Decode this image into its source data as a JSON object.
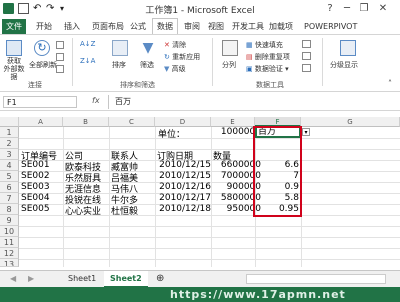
{
  "window": {
    "title": "工作簿1 - Microsoft Excel",
    "help": "?",
    "minimize": "─",
    "restore": "❐",
    "close": "✕"
  },
  "tabs": [
    "文件",
    "开始",
    "插入",
    "页面布局",
    "公式",
    "数据",
    "审阅",
    "视图",
    "开发工具",
    "加载项",
    "POWERPIVOT"
  ],
  "active_tab": "数据",
  "ribbon": {
    "get_external_label": "获取\n外部数据",
    "refresh_label": "全部刷新",
    "connections_group": "连接",
    "sort_label": "排序",
    "filter_label": "筛选",
    "clear_label": "清除",
    "reapply_label": "重新应用",
    "advanced_label": "高级",
    "sort_filter_group": "排序和筛选",
    "split_label": "分列",
    "flash_fill_label": "快速填充",
    "remove_dup_label": "删除重复项",
    "validation_label": "数据验证",
    "data_tools_group": "数据工具",
    "outline_label": "分级显示"
  },
  "formula_bar": {
    "name_box": "F1",
    "fx": "fx",
    "value": "百万"
  },
  "columns": [
    "A",
    "B",
    "C",
    "D",
    "E",
    "F",
    "G"
  ],
  "rows": [
    "1",
    "2",
    "3",
    "4",
    "5",
    "6",
    "7",
    "8",
    "9",
    "10",
    "11",
    "12",
    "13"
  ],
  "cells": {
    "D1": "单位：",
    "E1": "1000000",
    "F1": "百万",
    "A3": "订单编号",
    "B3": "公司",
    "C3": "联系人",
    "D3": "订购日期",
    "E3": "数量",
    "A4": "SE001",
    "B4": "欧泰科技",
    "C4": "臧富帅",
    "D4": "2010/12/15",
    "E4": "6600000",
    "F4": "6.6",
    "A5": "SE002",
    "B5": "乐然厨具",
    "C5": "吕福美",
    "D5": "2010/12/15",
    "E5": "7000000",
    "F5": "7",
    "A6": "SE003",
    "B6": "无涯信息",
    "C6": "马伟八",
    "D6": "2010/12/16",
    "E6": "900000",
    "F6": "0.9",
    "A7": "SE004",
    "B7": "投锐在线",
    "C7": "牛尔多",
    "D7": "2010/12/17",
    "E7": "5800000",
    "F7": "5.8",
    "A8": "SE005",
    "B8": "心心实业",
    "C8": "杜恒毅",
    "D8": "2010/12/18",
    "E8": "950000",
    "F8": "0.95"
  },
  "sheets": [
    "Sheet1",
    "Sheet2"
  ],
  "active_sheet": "Sheet2",
  "watermark": "https://www.17apmn.net",
  "colors": {
    "accent": "#217346",
    "highlight_box": "#d0021b"
  }
}
